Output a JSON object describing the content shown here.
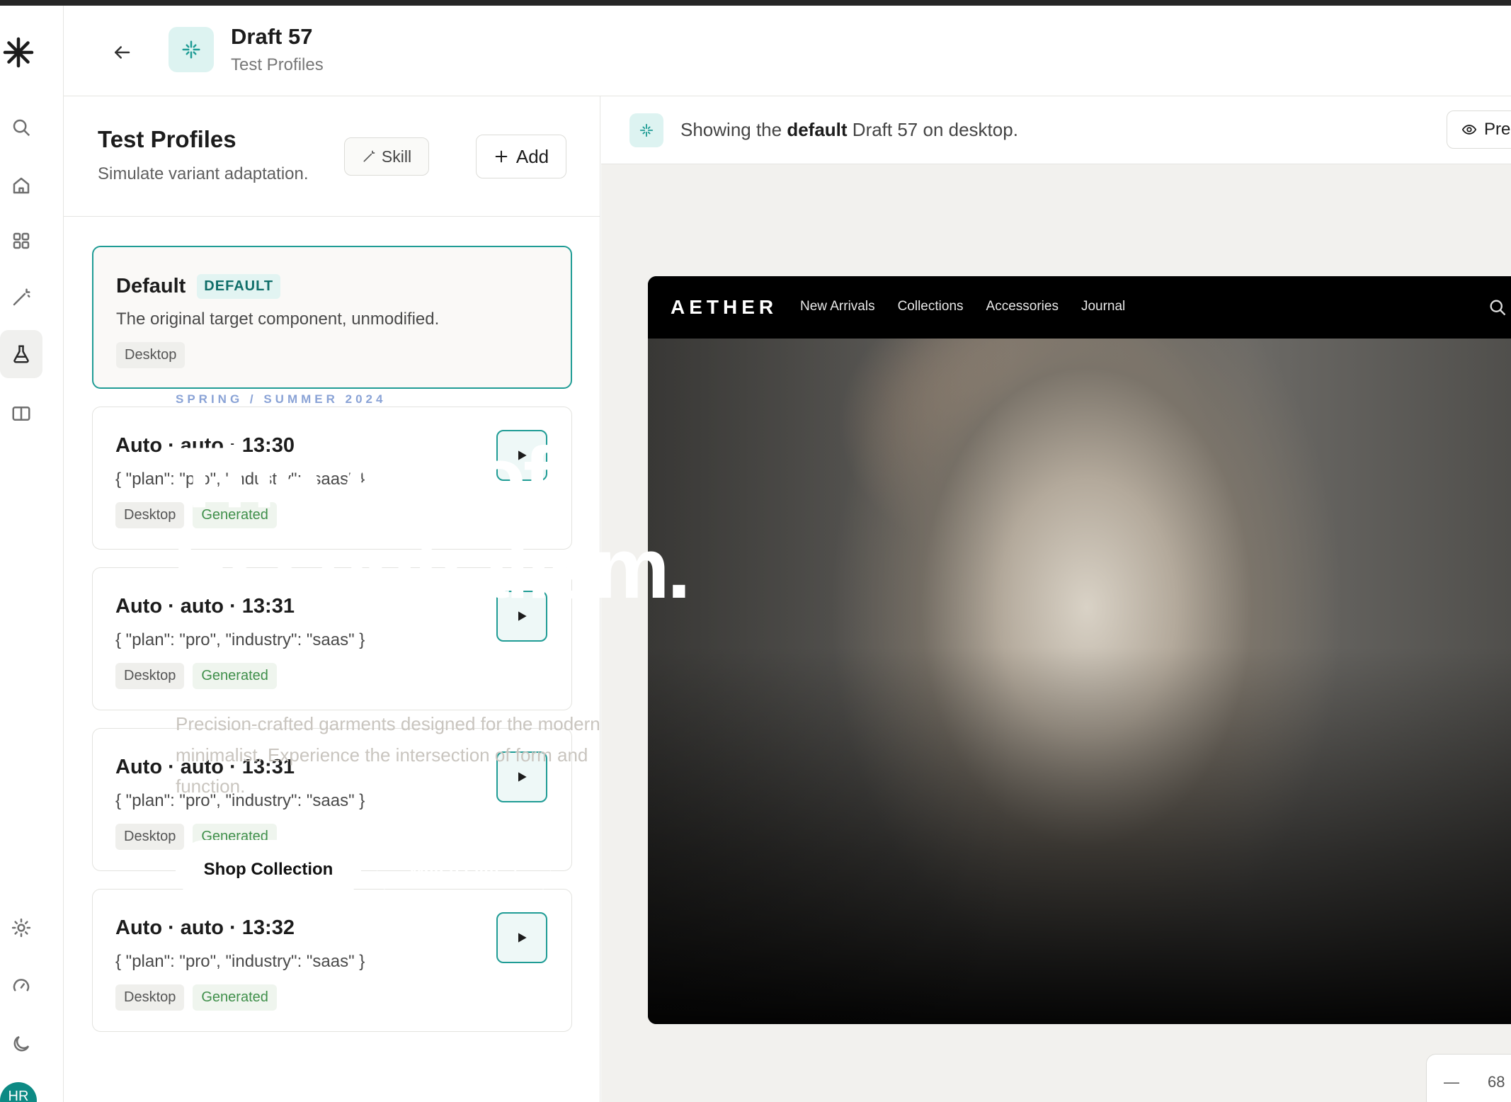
{
  "header": {
    "title": "Draft 57",
    "subtitle": "Test Profiles"
  },
  "sidebar": {
    "items": [
      {
        "icon": "search-icon"
      },
      {
        "icon": "home-icon"
      },
      {
        "icon": "grid-icon"
      },
      {
        "icon": "wand-icon"
      },
      {
        "icon": "flask-icon",
        "active": true
      },
      {
        "icon": "book-icon"
      }
    ],
    "bottom": [
      {
        "icon": "sun-icon"
      },
      {
        "icon": "gauge-icon"
      },
      {
        "icon": "moon-icon"
      }
    ],
    "avatar_initials": "HR"
  },
  "panel": {
    "title": "Test Profiles",
    "subtitle": "Simulate variant adaptation.",
    "skill_label": "Skill",
    "add_label": "Add"
  },
  "profiles": [
    {
      "title": "Default",
      "badge": "DEFAULT",
      "desc": "The original target component, unmodified.",
      "tags": [
        "Desktop"
      ]
    },
    {
      "title": "Auto · auto · 13:30",
      "desc": "{ \"plan\": \"pro\", \"industry\": \"saas\" }",
      "tags": [
        "Desktop",
        "Generated"
      ]
    },
    {
      "title": "Auto · auto · 13:31",
      "desc": "{ \"plan\": \"pro\", \"industry\": \"saas\" }",
      "tags": [
        "Desktop",
        "Generated"
      ]
    },
    {
      "title": "Auto · auto · 13:31",
      "desc": "{ \"plan\": \"pro\", \"industry\": \"saas\" }",
      "tags": [
        "Desktop",
        "Generated"
      ]
    },
    {
      "title": "Auto · auto · 13:32",
      "desc": "{ \"plan\": \"pro\", \"industry\": \"saas\" }",
      "tags": [
        "Desktop",
        "Generated"
      ]
    }
  ],
  "info_bar": {
    "text_prefix": "Showing the ",
    "text_bold": "default",
    "text_suffix": " Draft 57 on desktop.",
    "preview_label": "Pre"
  },
  "zoom": {
    "minus": "—",
    "value": "68"
  },
  "site": {
    "logo": "AETHER",
    "menu": [
      "New Arrivals",
      "Collections",
      "Accessories",
      "Journal"
    ],
    "eyebrow": "SPRING / SUMMER 2024",
    "headline_1": "The Art of",
    "headline_2": "Essentialism.",
    "description": "Precision-crafted garments designed for the modern minimalist. Experience the intersection of form and function.",
    "cta_primary": "Shop Collection",
    "cta_secondary": "Watch Film"
  },
  "colors": {
    "accent": "#1f9c95",
    "accent_soft": "#ddf3f1",
    "generated_tag": "#3f8f4a"
  }
}
